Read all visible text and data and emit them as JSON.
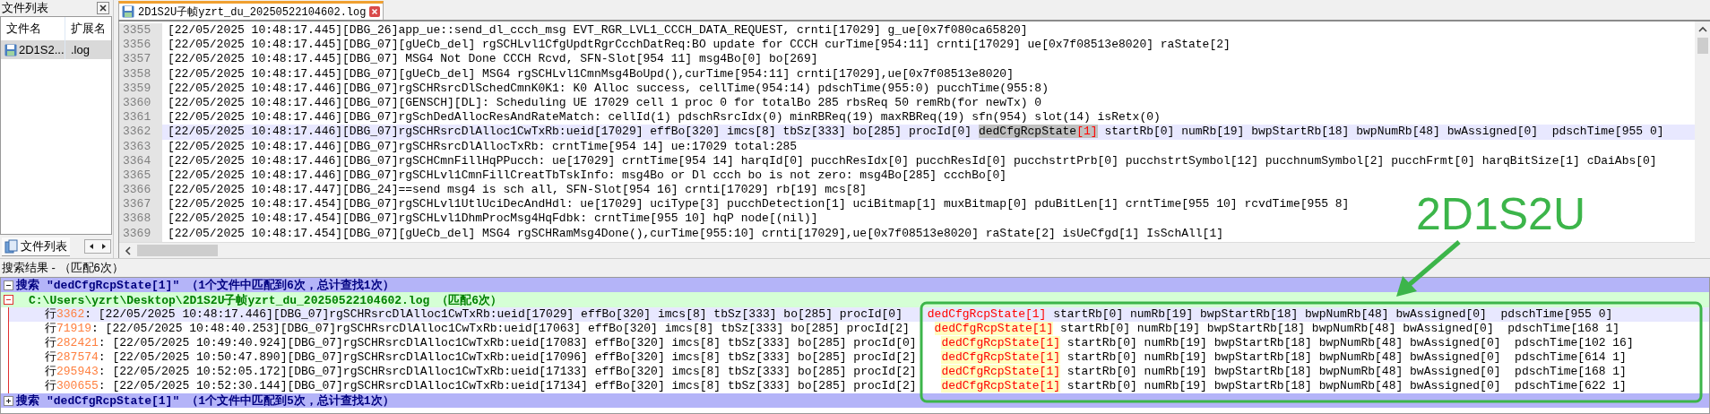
{
  "file_list": {
    "title": "文件列表",
    "columns": [
      "文件名",
      "扩展名"
    ],
    "rows": [
      {
        "name": "2D1S2...",
        "ext": ".log",
        "selected": true
      }
    ],
    "bottom_tab": "文件列表"
  },
  "editor": {
    "tab": {
      "title": "2D1S2U子帧yzrt_du_20250522104602.log"
    },
    "lines": [
      {
        "number": "3355",
        "text": "[22/05/2025 10:48:17.445][DBG_26]app_ue::send_dl_ccch_msg EVT_RGR_LVL1_CCCH_DATA_REQUEST, crnti[17029] g_ue[0x7f080ca65820]",
        "selected": false
      },
      {
        "number": "3356",
        "text": "[22/05/2025 10:48:17.445][DBG_07][gUeCb_del] rgSCHLvl1CfgUpdtRgrCcchDatReq:BO update for CCCH curTime[954:11] crnti[17029] ue[0x7f08513e8020] raState[2]",
        "selected": false
      },
      {
        "number": "3357",
        "text": "[22/05/2025 10:48:17.445][DBG_07] MSG4 Not Done CCCH Rcvd, SFN-Slot[954 11] msg4Bo[0] bo[269]",
        "selected": false
      },
      {
        "number": "3358",
        "text": "[22/05/2025 10:48:17.445][DBG_07][gUeCb_del] MSG4 rgSCHLvl1CmnMsg4BoUpd(),curTime[954:11] crnti[17029],ue[0x7f08513e8020]",
        "selected": false
      },
      {
        "number": "3359",
        "text": "[22/05/2025 10:48:17.446][DBG_07]rgSCHRsrcDlSchedCmnK0K1: K0 Alloc success, cellTime(954:14) pdschTime(955:0) pucchTime(955:8)",
        "selected": false
      },
      {
        "number": "3360",
        "text": "[22/05/2025 10:48:17.446][DBG_07][GENSCH][DL]: Scheduling UE 17029 cell 1 proc 0 for totalBo 285 rbsReq 50 remRb(for newTx) 0",
        "selected": false
      },
      {
        "number": "3361",
        "text": "[22/05/2025 10:48:17.446][DBG_07]rgSchDedAllocResAndRateMatch: cellId(1) pdschRsrcIdx(0) minRBReq(19) maxRBReq(19) sfn(954) slot(14) isRetx(0)",
        "selected": false
      },
      {
        "number": "3362",
        "parts": [
          {
            "kind": "plain",
            "text": "[22/05/2025 10:48:17.446][DBG_07]rgSCHRsrcDlAlloc1CwTxRb:ueid[17029] effBo[320] imcs[8] tbSz[333] bo[285] procId[0] "
          },
          {
            "kind": "mark",
            "text": "dedCfgRcpState"
          },
          {
            "kind": "bracket",
            "text": "[1]"
          },
          {
            "kind": "plain",
            "text": " startRb[0] numRb[19] bwpStartRb[18] bwpNumRb[48] bwAssigned[0]  pdschTime[955 0]"
          }
        ],
        "selected": true
      },
      {
        "number": "3363",
        "text": "[22/05/2025 10:48:17.446][DBG_07]rgSCHRsrcDlAllocTxRb: crntTime[954 14] ue:17029 total:285",
        "selected": false
      },
      {
        "number": "3364",
        "text": "[22/05/2025 10:48:17.446][DBG_07]rgSCHCmnFillHqPPucch: ue[17029] crntTime[954 14] harqId[0] pucchResIdx[0] pucchResId[0] pucchstrtPrb[0] pucchstrtSymbol[12] pucchnumSymbol[2] pucchFrmt[0] harqBitSize[1] cDaiAbs[0]",
        "selected": false
      },
      {
        "number": "3365",
        "text": "[22/05/2025 10:48:17.446][DBG_07]rgSCHLvl1CmnFillCreatTbTskInfo: msg4Bo or Dl ccch bo is not zero: msg4Bo[285] ccchBo[0]",
        "selected": false
      },
      {
        "number": "3366",
        "text": "[22/05/2025 10:48:17.447][DBG_24]==send msg4 is sch all, SFN-Slot[954 16] crnti[17029] rb[19] mcs[8]",
        "selected": false
      },
      {
        "number": "3367",
        "text": "[22/05/2025 10:48:17.454][DBG_07]rgSCHLvl1UtlUciDecAndHdl: ue[17029] uciType[3] pucchDetection[1] uciBitmap[1] muxBitmap[0] pduBitLen[1] crntTime[955 10] rcvdTime[955 8]",
        "selected": false
      },
      {
        "number": "3368",
        "text": "[22/05/2025 10:48:17.454][DBG_07]rgSCHLvl1DhmProcMsg4HqFdbk: crntTime[955 10] hqP node[(nil)]",
        "selected": false
      },
      {
        "number": "3369",
        "text": "[22/05/2025 10:48:17.454][DBG_07][gUeCb_del] MSG4 rgSCHRamMsg4Done(),curTime[955:10] crnti[17029],ue[0x7f08513e8020] raState[2] isUeCfgd[1] IsSchAll[1]",
        "selected": false
      }
    ]
  },
  "search_results": {
    "title": "搜索结果 - （匹配6次）",
    "searches": [
      {
        "label": "搜索",
        "query": "\"dedCfgRcpState[1]\"",
        "summary": "（1个文件中匹配到6次，总计查找1次）",
        "expanded": true,
        "files": [
          {
            "path": "C:\\Users\\yzrt\\Desktop\\2D1S2U子帧yzrt_du_20250522104602.log",
            "count": "（匹配6次）",
            "hits": [
              {
                "prefix": "行",
                "line": "3362",
                "before": ": [22/05/2025 10:48:17.446][DBG_07]rgSCHRsrcDlAlloc1CwTxRb:ueid[17029] effBo[320] imcs[8] tbSz[333] bo[285] procId[0] ",
                "match": "dedCfgRcpState[1]",
                "after": " startRb[0] numRb[19] bwpStartRb[18] bwpNumRb[48] bwAssigned[0]  pdschTime[955 0]",
                "selected": true
              },
              {
                "prefix": "行",
                "line": "71919",
                "before": ": [22/05/2025 10:48:40.253][DBG_07]rgSCHRsrcDlAlloc1CwTxRb:ueid[17063] effBo[320] imcs[8] tbSz[333] bo[285] procId[2] ",
                "match": "dedCfgRcpState[1]",
                "after": " startRb[0] numRb[19] bwpStartRb[18] bwpNumRb[48] bwAssigned[0]  pdschTime[168 1]",
                "selected": false
              },
              {
                "prefix": "行",
                "line": "282421",
                "before": ": [22/05/2025 10:49:40.924][DBG_07]rgSCHRsrcDlAlloc1CwTxRb:ueid[17083] effBo[320] imcs[8] tbSz[333] bo[285] procId[0] ",
                "match": "dedCfgRcpState[1]",
                "after": " startRb[0] numRb[19] bwpStartRb[18] bwpNumRb[48] bwAssigned[0]  pdschTime[102 16]",
                "selected": false
              },
              {
                "prefix": "行",
                "line": "287574",
                "before": ": [22/05/2025 10:50:47.890][DBG_07]rgSCHRsrcDlAlloc1CwTxRb:ueid[17096] effBo[320] imcs[8] tbSz[333] bo[285] procId[2] ",
                "match": "dedCfgRcpState[1]",
                "after": " startRb[0] numRb[19] bwpStartRb[18] bwpNumRb[48] bwAssigned[0]  pdschTime[614 1]",
                "selected": false
              },
              {
                "prefix": "行",
                "line": "295943",
                "before": ": [22/05/2025 10:52:05.172][DBG_07]rgSCHRsrcDlAlloc1CwTxRb:ueid[17133] effBo[320] imcs[8] tbSz[333] bo[285] procId[2] ",
                "match": "dedCfgRcpState[1]",
                "after": " startRb[0] numRb[19] bwpStartRb[18] bwpNumRb[48] bwAssigned[0]  pdschTime[168 1]",
                "selected": false
              },
              {
                "prefix": "行",
                "line": "300655",
                "before": ": [22/05/2025 10:52:30.144][DBG_07]rgSCHRsrcDlAlloc1CwTxRb:ueid[17134] effBo[320] imcs[8] tbSz[333] bo[285] procId[2] ",
                "match": "dedCfgRcpState[1]",
                "after": " startRb[0] numRb[19] bwpStartRb[18] bwpNumRb[48] bwAssigned[0]  pdschTime[622 1]",
                "selected": false
              }
            ]
          }
        ]
      },
      {
        "label": "搜索",
        "query": "\"dedCfgRcpState[1]\"",
        "summary": "（1个文件中匹配到5次，总计查找1次）",
        "expanded": false
      }
    ]
  },
  "annotation": {
    "label": "2D1S2U"
  }
}
